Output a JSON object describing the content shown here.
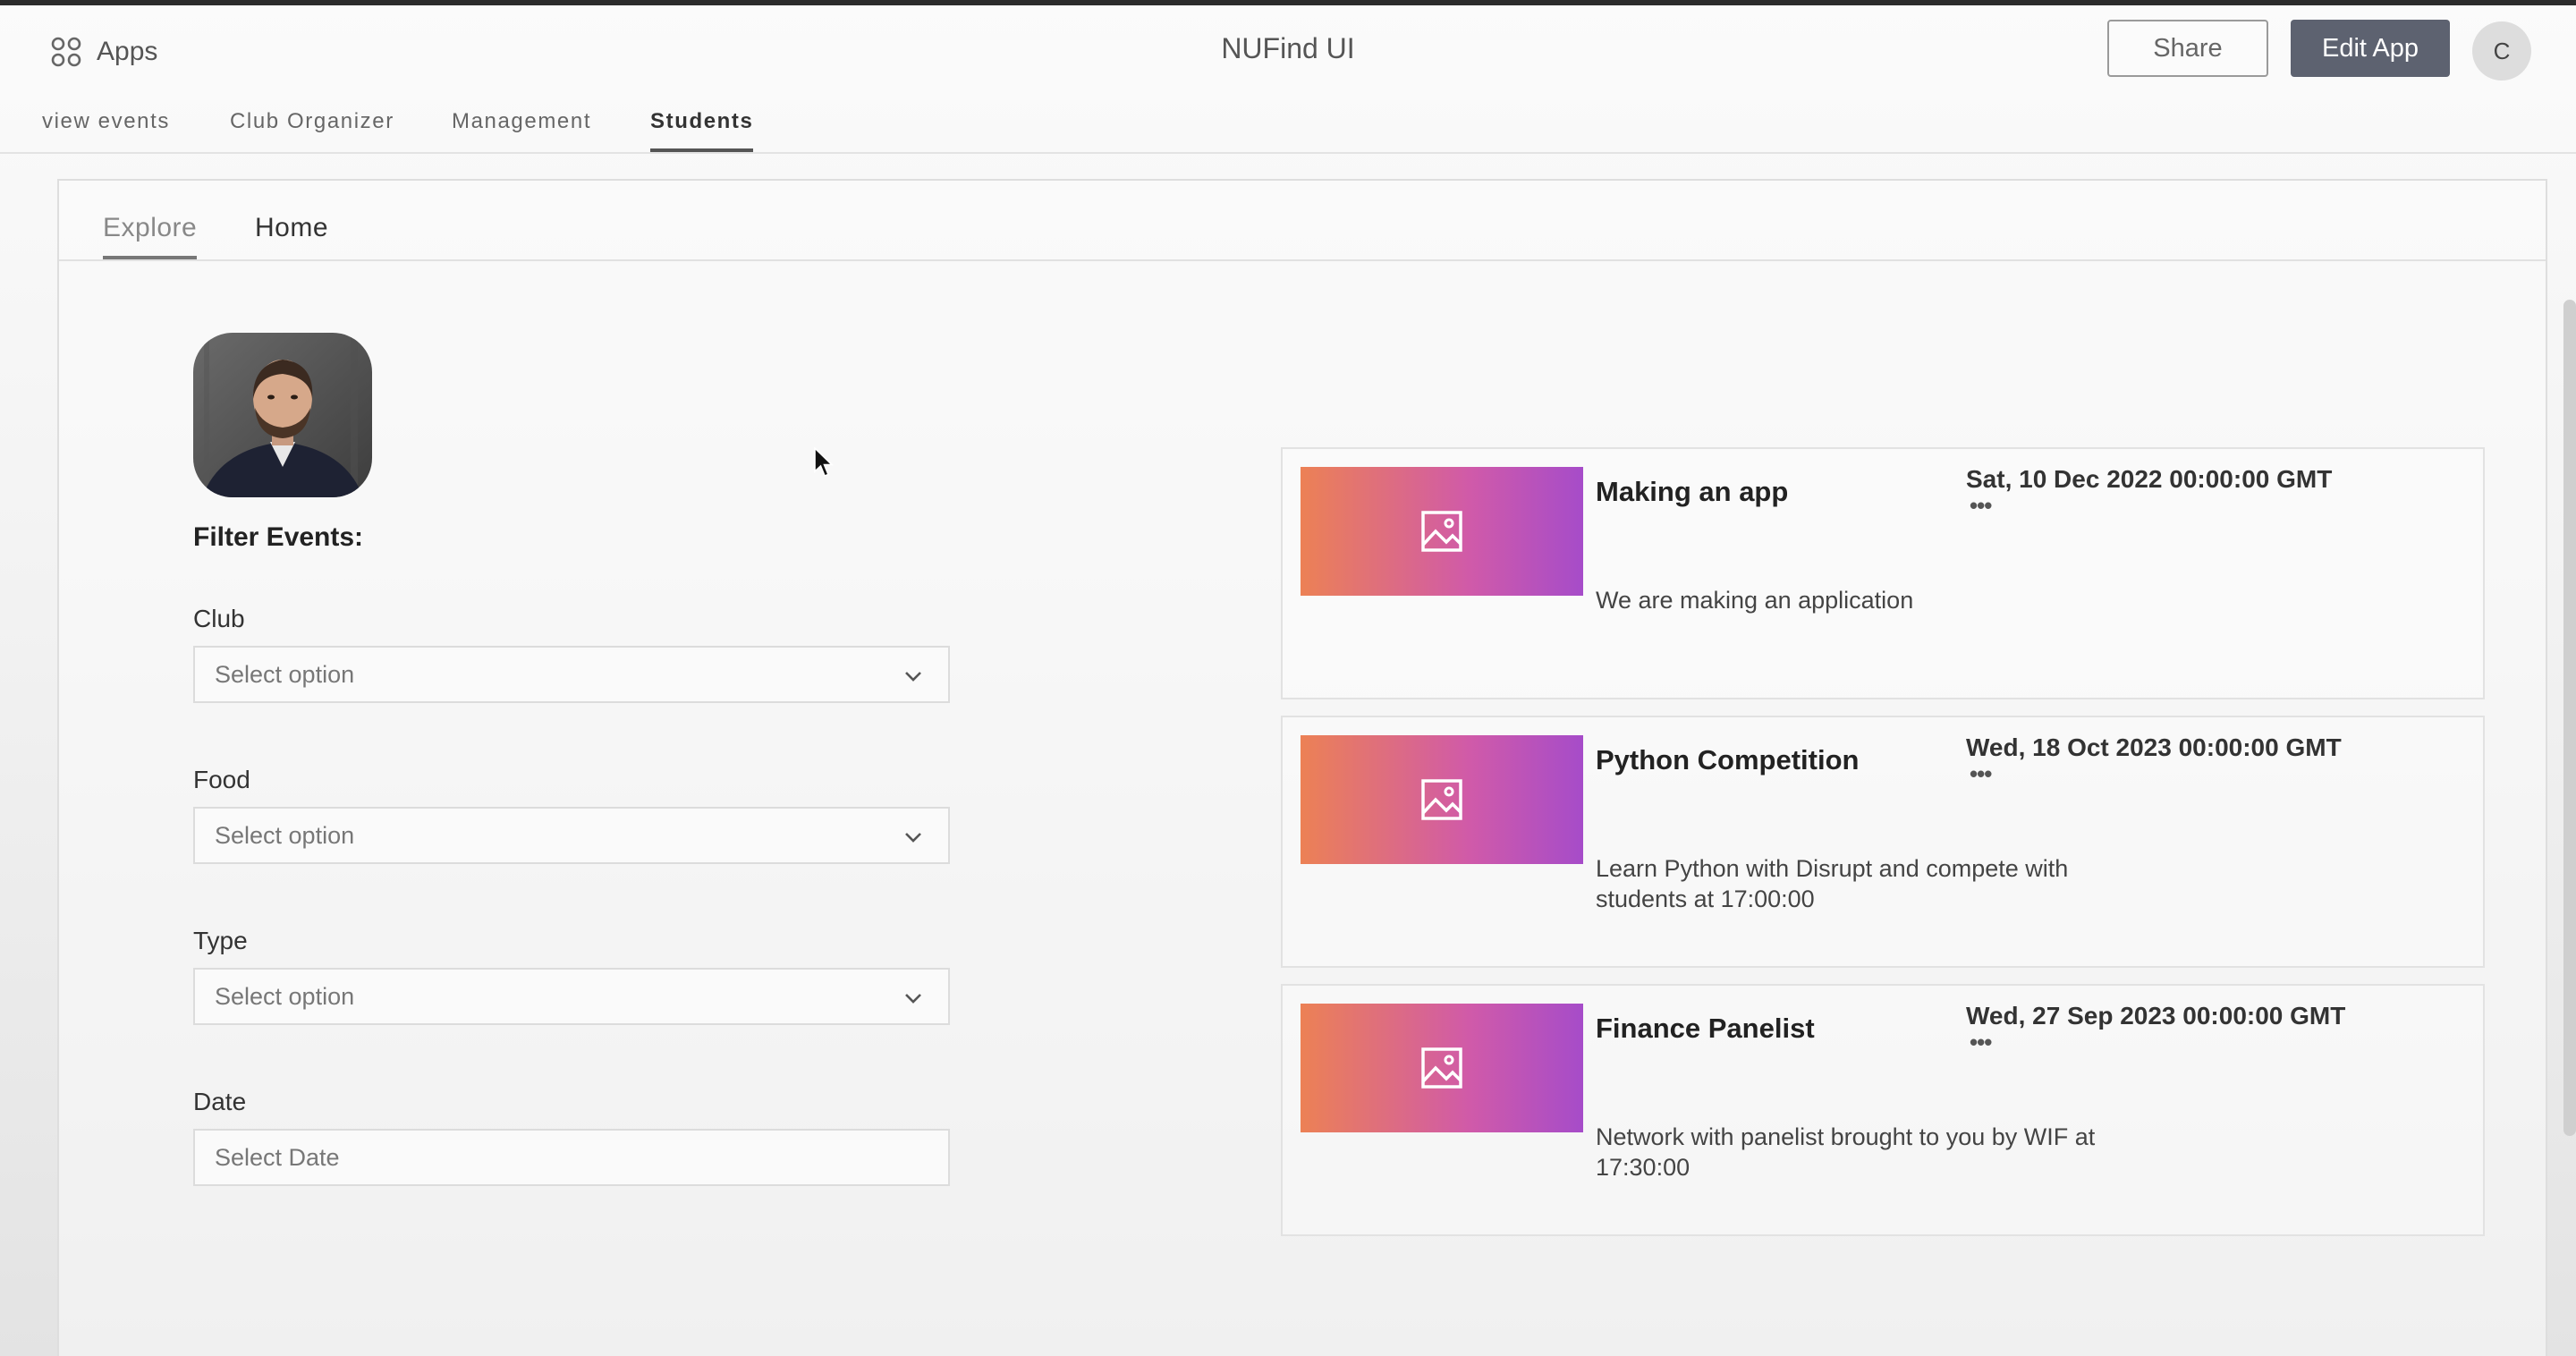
{
  "header": {
    "apps_label": "Apps",
    "app_title": "NUFind UI",
    "share_label": "Share",
    "edit_label": "Edit App",
    "user_initial": "C"
  },
  "nav_tabs": [
    {
      "label": "view events",
      "active": false
    },
    {
      "label": "Club Organizer",
      "active": false
    },
    {
      "label": "Management",
      "active": false
    },
    {
      "label": "Students",
      "active": true
    }
  ],
  "sub_tabs": [
    {
      "label": "Explore",
      "active": true
    },
    {
      "label": "Home",
      "active": false
    }
  ],
  "filters": {
    "heading": "Filter Events:",
    "club": {
      "label": "Club",
      "placeholder": "Select option"
    },
    "food": {
      "label": "Food",
      "placeholder": "Select option"
    },
    "type": {
      "label": "Type",
      "placeholder": "Select option"
    },
    "date": {
      "label": "Date",
      "placeholder": "Select Date"
    }
  },
  "events": [
    {
      "title": "Making an app",
      "date": "Sat, 10 Dec 2022 00:00:00 GMT",
      "more": "•••",
      "description": "We are making an application"
    },
    {
      "title": "Python Competition",
      "date": "Wed, 18 Oct 2023 00:00:00 GMT",
      "more": "•••",
      "description": "Learn Python with Disrupt and compete with students at 17:00:00"
    },
    {
      "title": "Finance Panelist",
      "date": "Wed, 27 Sep 2023 00:00:00 GMT",
      "more": "•••",
      "description": "Network with panelist brought to you by WIF at 17:30:00"
    }
  ],
  "colors": {
    "primary_button": "#5d6270",
    "thumb_gradient_start": "#ec8155",
    "thumb_gradient_end": "#a64cc9"
  },
  "icons": {
    "apps": "apps-grid-icon",
    "chevron": "chevron-down-icon",
    "thumbnail": "image-placeholder-icon",
    "cursor": "mouse-pointer-icon"
  }
}
